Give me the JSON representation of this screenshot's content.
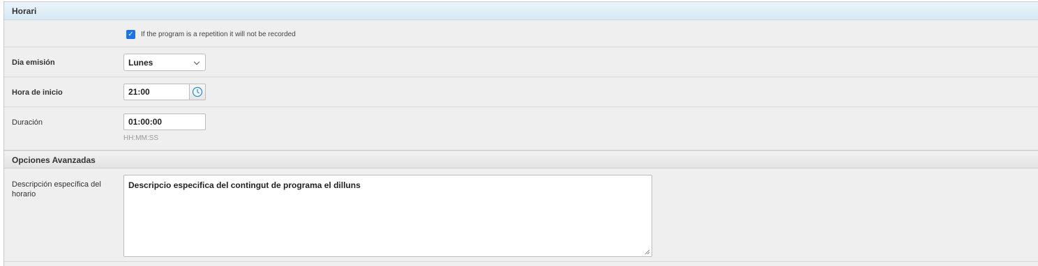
{
  "sections": {
    "horari": {
      "title": "Horari"
    },
    "avanzadas": {
      "title": "Opciones Avanzadas"
    }
  },
  "repetition": {
    "checked": true,
    "label": "If the program is a repetition it will not be recorded"
  },
  "dia_emision": {
    "label": "Dia emisión",
    "value": "Lunes"
  },
  "hora_inicio": {
    "label": "Hora de inicio",
    "value": "21:00"
  },
  "duracion": {
    "label": "Duración",
    "value": "01:00:00",
    "help": "HH:MM:SS"
  },
  "descripcion": {
    "label": "Descripción específica del horario",
    "value": "Descripcio especifica del contingut de programa el dilluns"
  },
  "icons": {
    "checkbox": "checkmark-icon",
    "select": "chevron-down-icon",
    "time": "clock-icon",
    "textarea": "resize-grip-icon"
  },
  "colors": {
    "header_blue": "#d7e9f4",
    "checkbox_accent": "#1a73e8",
    "clock_accent": "#3a8dc8"
  }
}
